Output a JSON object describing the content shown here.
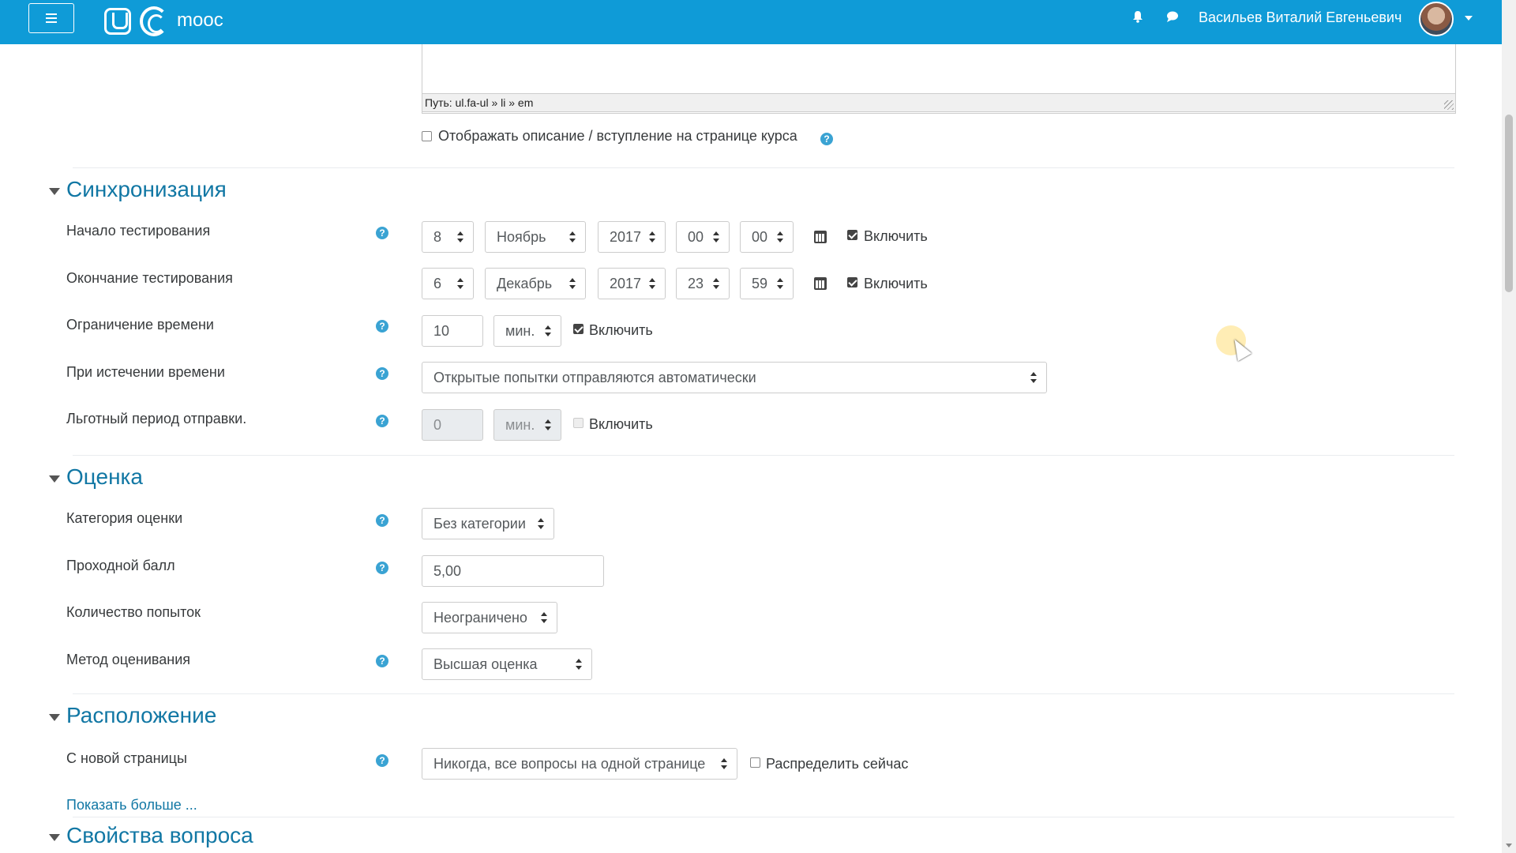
{
  "header": {
    "menu_label": "≡",
    "brand": "mooc",
    "user_name": "Васильев Виталий Евгеньевич",
    "colors": {
      "navbar": "#0f9bd7",
      "section_title": "#1177a4"
    }
  },
  "editor": {
    "path": "Путь: ul.fa-ul » li » em"
  },
  "description_option": {
    "label": "Отображать описание / вступление на странице курса",
    "checked": false
  },
  "sections": {
    "sync": {
      "title": "Синхронизация",
      "open": {
        "label": "Начало тестирования",
        "day": "8",
        "month": "Ноябрь",
        "year": "2017",
        "hour": "00",
        "minute": "00",
        "enable_label": "Включить",
        "enabled": true
      },
      "close": {
        "label": "Окончание тестирования",
        "day": "6",
        "month": "Декабрь",
        "year": "2017",
        "hour": "23",
        "minute": "59",
        "enable_label": "Включить",
        "enabled": true
      },
      "time_limit": {
        "label": "Ограничение времени",
        "value": "10",
        "unit": "мин.",
        "enable_label": "Включить",
        "enabled": true
      },
      "on_expire": {
        "label": "При истечении времени",
        "value": "Открытые попытки отправляются автоматически"
      },
      "grace": {
        "label": "Льготный период отправки.",
        "value": "0",
        "unit": "мин.",
        "enable_label": "Включить",
        "enabled": false
      }
    },
    "grade": {
      "title": "Оценка",
      "category": {
        "label": "Категория оценки",
        "value": "Без категории"
      },
      "pass": {
        "label": "Проходной балл",
        "value": "5,00"
      },
      "attempts": {
        "label": "Количество попыток",
        "value": "Неограничено"
      },
      "method": {
        "label": "Метод оценивания",
        "value": "Высшая оценка"
      }
    },
    "layout": {
      "title": "Расположение",
      "new_page": {
        "label": "С новой страницы",
        "value": "Никогда, все вопросы на одной странице"
      },
      "repaginate": {
        "label": "Распределить сейчас",
        "checked": false
      },
      "show_more": "Показать больше ..."
    },
    "question": {
      "title": "Свойства вопроса"
    }
  },
  "help_symbol": "?"
}
